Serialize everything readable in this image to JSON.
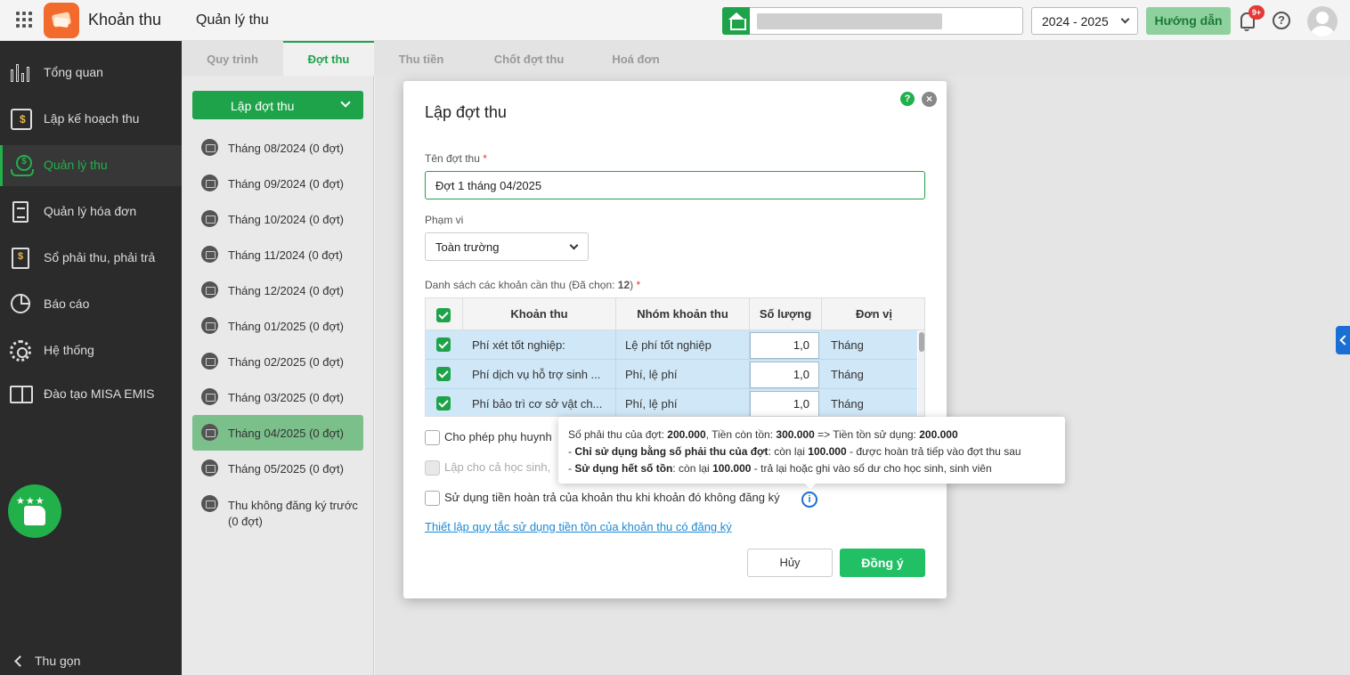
{
  "app": {
    "name": "Khoản thu",
    "page_title": "Quản lý thu"
  },
  "header": {
    "school_year": "2024 - 2025",
    "guide_label": "Hướng dẫn",
    "notification_count": "9+"
  },
  "sidebar": {
    "items": [
      {
        "label": "Tổng quan"
      },
      {
        "label": "Lập kế hoạch thu"
      },
      {
        "label": "Quản lý thu"
      },
      {
        "label": "Quản lý hóa đơn"
      },
      {
        "label": "Sổ phải thu, phải trả"
      },
      {
        "label": "Báo cáo"
      },
      {
        "label": "Hệ thống"
      },
      {
        "label": "Đào tạo MISA EMIS"
      }
    ],
    "collapse_label": "Thu gọn",
    "rating_stars": "★★★"
  },
  "tabs": [
    {
      "label": "Quy trình"
    },
    {
      "label": "Đợt thu"
    },
    {
      "label": "Thu tiền"
    },
    {
      "label": "Chốt đợt thu"
    },
    {
      "label": "Hoá đơn"
    }
  ],
  "periods": {
    "create_label": "Lập đợt thu",
    "items": [
      {
        "label": "Tháng 08/2024 (0 đợt)"
      },
      {
        "label": "Tháng 09/2024 (0 đợt)"
      },
      {
        "label": "Tháng 10/2024 (0 đợt)"
      },
      {
        "label": "Tháng 11/2024 (0 đợt)"
      },
      {
        "label": "Tháng 12/2024 (0 đợt)"
      },
      {
        "label": "Tháng 01/2025 (0 đợt)"
      },
      {
        "label": "Tháng 02/2025 (0 đợt)"
      },
      {
        "label": "Tháng 03/2025 (0 đợt)"
      },
      {
        "label": "Tháng 04/2025 (0 đợt)"
      },
      {
        "label": "Tháng 05/2025 (0 đợt)"
      },
      {
        "label": "Thu không đăng ký trước (0 đợt)"
      }
    ]
  },
  "dialog": {
    "title": "Lập đợt thu",
    "help_icon": "?",
    "close_icon": "×",
    "name_label": "Tên đợt thu",
    "required_mark": "*",
    "name_value": "Đợt 1 tháng 04/2025",
    "scope_label": "Phạm vi",
    "scope_value": "Toàn trường",
    "list_label_prefix": "Danh sách các khoản cần thu (Đã chọn: ",
    "list_selected_count": "12",
    "list_label_suffix": ")",
    "table": {
      "headers": [
        "Khoản thu",
        "Nhóm khoản thu",
        "Số lượng",
        "Đơn vị"
      ],
      "rows": [
        {
          "item": "Phí xét tốt nghiệp:",
          "group": "Lệ phí tốt nghiệp",
          "qty": "1,0",
          "unit": "Tháng"
        },
        {
          "item": "Phí dịch vụ hỗ trợ sinh ...",
          "group": "Phí, lệ phí",
          "qty": "1,0",
          "unit": "Tháng"
        },
        {
          "item": "Phí bảo trì cơ sở vật ch...",
          "group": "Phí, lệ phí",
          "qty": "1,0",
          "unit": "Tháng"
        }
      ]
    },
    "options": [
      {
        "label": "Cho phép phụ huynh"
      },
      {
        "label": "Lập cho cả học sinh,"
      },
      {
        "label": "Sử dụng tiền hoàn trả của khoản thu khi khoản đó không đăng ký"
      }
    ],
    "info_icon": "i",
    "setup_link": "Thiết lập quy tắc sử dụng tiền tồn của khoản thu có đăng ký",
    "cancel_label": "Hủy",
    "ok_label": "Đồng ý"
  },
  "tooltip": {
    "line1": {
      "t1": "Số phải thu của đợt: ",
      "b1": "200.000",
      "t2": ", Tiền còn tồn: ",
      "b2": "300.000",
      "t3": " => Tiền tồn sử dụng: ",
      "b3": "200.000"
    },
    "line2": {
      "t1": "- ",
      "b1": "Chỉ sử dụng bằng số phải thu của đợt",
      "t2": ": còn lại ",
      "b2": "100.000",
      "t3": " - được hoàn trả tiếp vào đợt thu sau"
    },
    "line3": {
      "t1": "- ",
      "b1": "Sử dụng hết số tồn",
      "t2": ": còn lại ",
      "b2": "100.000",
      "t3": " - trả lại hoặc ghi vào số dư cho học sinh, sinh viên"
    }
  },
  "colors": {
    "brand_green": "#1ea34a",
    "app_logo": "#f26b2d",
    "selected_row": "#cfe7f7",
    "link": "#1a8ad6"
  }
}
